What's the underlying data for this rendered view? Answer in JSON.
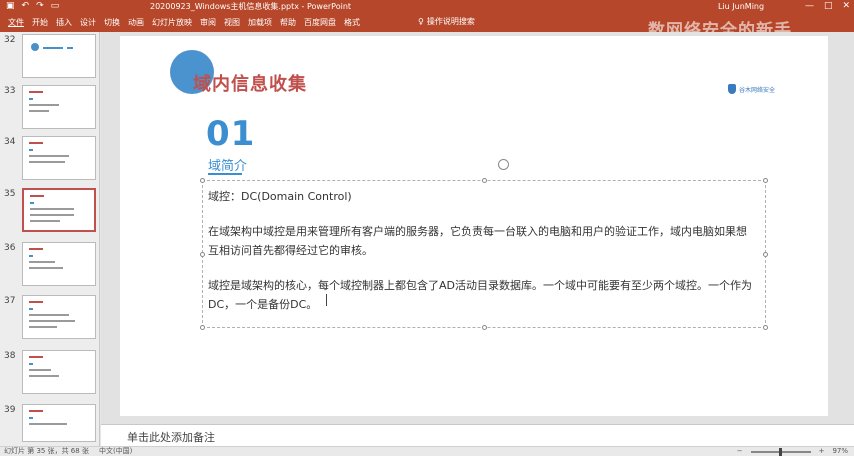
{
  "titlebar": {
    "qa_icons": [
      "save-icon",
      "undo-icon",
      "redo-icon",
      "present-icon"
    ],
    "title": "20200923_Windows主机信息收集.pptx - PowerPoint",
    "user": "Liu JunMing",
    "controls": [
      "—",
      "□",
      "✕"
    ]
  },
  "ribbon": {
    "tabs": [
      "文件",
      "开始",
      "插入",
      "设计",
      "切换",
      "动画",
      "幻灯片放映",
      "审阅",
      "视图",
      "加载项",
      "帮助",
      "百度网盘",
      "格式"
    ],
    "selected_tab": "文件",
    "search_label": "操作说明搜索"
  },
  "thumbnails": [
    {
      "num": "32",
      "selected": false
    },
    {
      "num": "33",
      "selected": false
    },
    {
      "num": "34",
      "selected": false
    },
    {
      "num": "35",
      "selected": true
    },
    {
      "num": "36",
      "selected": false
    },
    {
      "num": "37",
      "selected": false
    },
    {
      "num": "38",
      "selected": false
    },
    {
      "num": "39",
      "selected": false
    }
  ],
  "slide": {
    "title": "域内信息收集",
    "logo_text": "谷木网络安全",
    "number": "01",
    "section": "域简介",
    "p1": "域控：DC(Domain Control)",
    "p2_line1": "在域架构中域控是用来管理所有客户端的服务器，它负责每一台联入的电脑和用户的验证工作，域内电脑如果想",
    "p2_line2": "互相访问首先都得经过它的审核。",
    "p3_line1": "域控是域架构的核心，每个域控制器上都包含了AD活动目录数据库。一个域中可能要有至少两个域控。一个作为",
    "p3_line2": "DC，一个是备份DC。"
  },
  "notes": {
    "placeholder": "单击此处添加备注"
  },
  "status": {
    "slide_info": "幻灯片 第 35 张，共 68 张",
    "language": "中文(中国)",
    "zoom": "97%"
  },
  "watermark": "数网络安全的新手"
}
